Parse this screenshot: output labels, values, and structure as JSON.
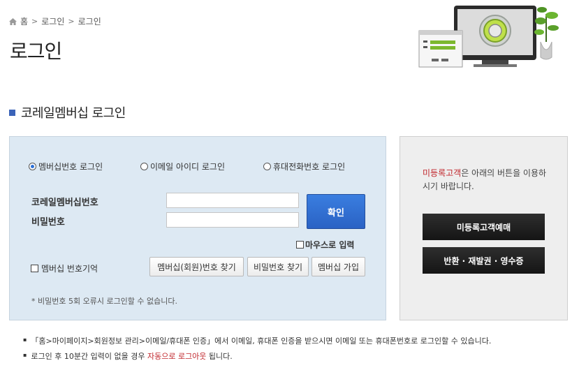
{
  "breadcrumb": {
    "home": "홈",
    "level1": "로그인",
    "level2": "로그인"
  },
  "page_title": "로그인",
  "section_title": "코레일멤버십 로그인",
  "login": {
    "radios": [
      {
        "label": "멤버십번호 로그인",
        "checked": true
      },
      {
        "label": "이메일 아이디 로그인",
        "checked": false
      },
      {
        "label": "휴대전화번호 로그인",
        "checked": false
      }
    ],
    "member_no_label": "코레일멤버십번호",
    "password_label": "비밀번호",
    "member_no_value": "",
    "password_value": "",
    "confirm_label": "확인",
    "mouse_input_label": "마우스로 입력",
    "remember_label": "멤버십 번호기억",
    "find_member_label": "멤버십(회원)번호 찾기",
    "find_password_label": "비밀번호 찾기",
    "join_label": "멤버십 가입",
    "notice": "* 비밀번호 5회 오류시 로그인할 수 없습니다."
  },
  "guest": {
    "msg_red": "미등록고객",
    "msg_rest": "은 아래의 버튼을 이용하시기 바랍니다.",
    "reserve_label": "미등록고객예매",
    "refund_label": "반환 · 재발권 · 영수증"
  },
  "notes": {
    "line1": "「홈>마이페이지>회원정보 관리>이메일/휴대폰 인증」에서 이메일, 휴대폰 인증을 받으시면 이메일 또는 휴대폰번호로 로그인할 수 있습니다.",
    "line2_pre": "로그인 후 10분간 입력이 없을 경우 ",
    "line2_red": "자동으로 로그아웃",
    "line2_post": " 됩니다."
  },
  "colors": {
    "accent_blue": "#2a62c4",
    "section_bullet": "#3b63b8",
    "warning_red": "#c1272d",
    "login_box_bg": "#dde9f3"
  },
  "icons": [
    "home-icon",
    "chevron-right-icon",
    "section-bullet-icon",
    "security-monitor-illustration"
  ]
}
